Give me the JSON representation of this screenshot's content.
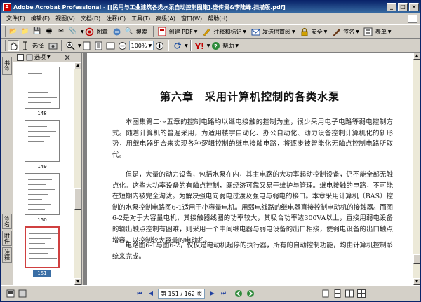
{
  "window": {
    "title": "Adobe Acrobat Professional - [[民用与工业建筑各类水泵自动控制图集].庞传贵&李陆峰.扫描版.pdf]",
    "app_icon_glyph": "A",
    "minimize": "_",
    "maximize": "□",
    "close": "×"
  },
  "menu": {
    "items": [
      "文件(F)",
      "编辑(E)",
      "视图(V)",
      "文档(D)",
      "注释(C)",
      "工具(T)",
      "高级(A)",
      "窗口(W)",
      "帮助(H)"
    ]
  },
  "toolbar1": {
    "icons": {
      "open": "📂",
      "folder": "📁",
      "save": "💾",
      "print": "🖶",
      "email": "✉",
      "attach": "📎",
      "search": "🔍"
    },
    "stamp_label": "图章",
    "search_label": "搜索",
    "create_pdf_label": "创建 PDF",
    "comment_label": "注释和标记",
    "review_label": "发送供审阅",
    "security_label": "安全",
    "sign_label": "签名",
    "form_label": "表单"
  },
  "toolbar2": {
    "select_label": "选择",
    "zoom_value": "100%",
    "help_label": "帮助"
  },
  "left_tabs": {
    "bookmarks": "书签",
    "signatures": "签名",
    "attachments": "附件",
    "comments": "注释"
  },
  "panel": {
    "options_label": "选项",
    "thumbnails": [
      {
        "label": "148"
      },
      {
        "label": "149"
      },
      {
        "label": "150"
      },
      {
        "label": "151"
      }
    ]
  },
  "document": {
    "chapter_title": "第六章　采用计算机控制的各类水泵",
    "paragraphs": [
      "本图集第二～五章的控制电路均以继电接触的控制为主，很少采用电子电路等弱电控制方式。随着计算机的普遍采用，为适用楼宇自动化、办公自动化、动力设备控制计算机化的新形势，用继电器组合来实现各种逻辑控制的继电接触电路，将逐步被智能化无触点控制电路所取代。",
      "但是，大量的动力设备，包括水泵在内，其主电路的大功率起动控制设备，仍不能全部无触点化。这些大功率设备的有触点控制，既经济可靠又易于维护与管理。继电接触的电路，不可能在短期内被完全淘汰。为解决强电向弱电过渡及强电与弱电的接口。本章采用计算机（BAS）控制的水泵控制电路图6-1适用于小容量电机。用弱电线路的继电器直接控制电动机的接触器。而图6-2是对于大容量电机，其接触器线圈的功率较大，其吸合功率达300VA以上，直接用弱电设备的输出触点控制有困难，则采用一个中间继电器与弱电设备的出口相接，使弱电设备的出口触点增容，以控制较大容量的电动机。",
      "电路图6-1与图6-2，仅仅是电动机起停的执行器，所有的自动控制功能，均由计算机控制系统来完成。"
    ]
  },
  "status": {
    "page_display": "第 151 / 162 页",
    "nav_first": "⏮",
    "nav_prev": "◀",
    "nav_next": "▶",
    "nav_last": "⏭"
  }
}
